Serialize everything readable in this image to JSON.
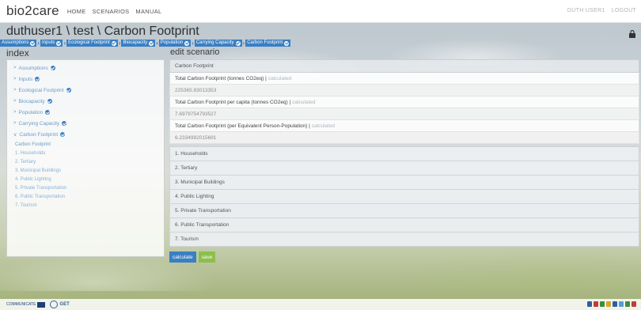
{
  "brand": "bio2care",
  "nav": [
    "HOME",
    "SCENARIOS",
    "MANUAL"
  ],
  "user": {
    "name": "DUTH USER1",
    "logout": "LOGOUT"
  },
  "page_title": "duthuser1 \\ test \\ Carbon Footprint",
  "steps": [
    "Assumptions",
    "Inputs",
    "Ecological Footprint",
    "Biocapacity",
    "Population",
    "Carrying Capacity",
    "Carbon Footprint"
  ],
  "index": {
    "title": "index",
    "items": [
      "Assumptions",
      "Inputs",
      "Ecological Footprint",
      "Biocapacity",
      "Population",
      "Carrying Capacity",
      "Carbon Footprint"
    ],
    "subitems": [
      "Carbon Footprint",
      "1. Households",
      "2. Tertiary",
      "3. Municipal Buildings",
      "4. Public Lighting",
      "5. Private Transportation",
      "6. Public Transportation",
      "7. Tourism"
    ]
  },
  "edit": {
    "title": "edit scenario",
    "section": "Carbon Footprint",
    "calculated_tag": "calculated",
    "fields": [
      {
        "label": "Total Carbon Footprint (tonnes CO2eq) |",
        "value": "225365.93013353"
      },
      {
        "label": "Total Carbon Footprint per capita (tonnes CO2eq) |",
        "value": "7.6979754793527"
      },
      {
        "label": "Total Carbon Footprint (per Equivalent Person-Population) |",
        "value": "6.2334992015691"
      }
    ],
    "accordions": [
      "1. Households",
      "2. Tertiary",
      "3. Municipal Buildings",
      "4. Public Lighting",
      "5. Private Transportation",
      "6. Public Transportation",
      "7. Tourism"
    ],
    "calculate_label": "calculate",
    "save_label": "save"
  },
  "footer": {
    "logo_text": "GET",
    "left_label": "COMMUNICATE"
  },
  "colors": {
    "accent": "#3a7fc3",
    "save": "#8cbf4d",
    "link": "#6c9acb"
  }
}
